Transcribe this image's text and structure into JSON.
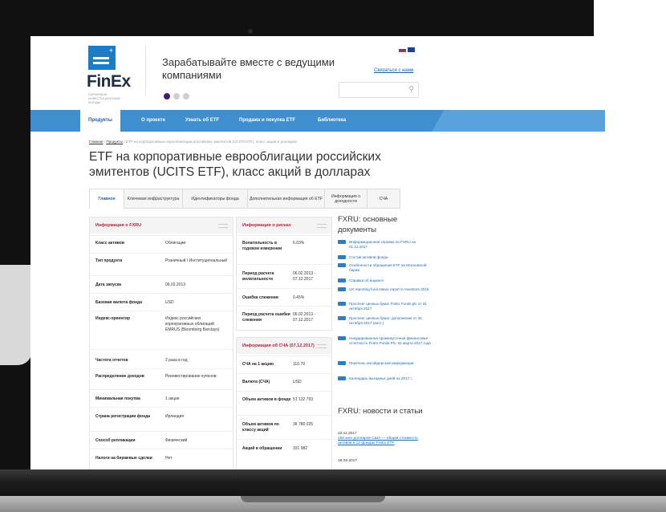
{
  "header": {
    "logo_text": "FinEx",
    "logo_sub": [
      "БИРЖЕВЫЕ",
      "ИНВЕСТИЦИОННЫЕ",
      "ФОНДЫ"
    ],
    "tagline": "Зарабатывайте вместе с ведущими компаниями",
    "contact_link": "Связаться с нами",
    "search_placeholder": ""
  },
  "nav": {
    "items": [
      "Продукты",
      "О проекте",
      "Узнать об ETF",
      "Продажа и покупка ETF",
      "Библиотека"
    ]
  },
  "breadcrumb": {
    "home": "Главная",
    "products": "Продукты",
    "current": "ETF на корпоративные еврооблигации российских эмитентов (UCITS ETF), класс акций в долларах"
  },
  "page_title": "ETF на корпоративные еврооблигации российских эмитентов (UCITS ETF), класс акций в долларах",
  "tabs": [
    "Главное",
    "Ключевая инфраструктура",
    "Идентификаторы фонда",
    "Дополнительная информация об ETF",
    "Информация о доходности",
    "СЧА"
  ],
  "info_panel": {
    "title": "Информация о FXRU",
    "rows": [
      {
        "k": "Класс активов",
        "v": "Облигации"
      },
      {
        "k": "Тип продукта",
        "v": "Розничный / Институциональный"
      },
      {
        "k": "Дата запуска",
        "v": "06.02.2013"
      },
      {
        "k": "Базовая валюта фонда",
        "v": "USD"
      },
      {
        "k": "Индекс-ориентир",
        "v": "Индекс российских корпоративных облигаций EMRUS (Bloomberg Barclays)"
      },
      {
        "k": "Частота отчетов",
        "v": "2 раза в год"
      },
      {
        "k": "Распределение доходов",
        "v": "Реинвестирование купонов"
      },
      {
        "k": "Минимальная покупка",
        "v": "1 акция"
      },
      {
        "k": "Страна регистрации фонда",
        "v": "Ирландия"
      },
      {
        "k": "Способ репликации",
        "v": "Физический"
      },
      {
        "k": "Налоги на биржевые сделки",
        "v": "Нет"
      }
    ]
  },
  "risk_panel": {
    "title": "Информация о рисках",
    "rows": [
      {
        "k": "Волатильность в годовом измерении",
        "v": "6.03%"
      },
      {
        "k": "Период расчета волатильности",
        "v": "06.02.2013 - 07.12.2017"
      },
      {
        "k": "Ошибка слежения",
        "v": "0.45%"
      },
      {
        "k": "Период расчета ошибки слежения",
        "v": "06.02.2013 - 07.12.2017"
      }
    ]
  },
  "nav_panel": {
    "title": "Информация об СЧА (07.12.2017)",
    "rows": [
      {
        "k": "СЧА на 1 акцию",
        "v": "110.79"
      },
      {
        "k": "Валюта (СЧА)",
        "v": "USD"
      },
      {
        "k": "Объем активов в фонде",
        "v": "51 132 793"
      },
      {
        "k": "Объем активов по классу акций",
        "v": "36 780 025"
      },
      {
        "k": "Акций в обращении",
        "v": "331 982"
      }
    ]
  },
  "docs": {
    "title": "FXRU: основные документы",
    "items": [
      "Информационная справка по FXRU на 01.12.2017",
      "Состав активов фонда",
      "Особенности обращения ETF на Московской бирже",
      "Справка об индексе",
      "UK reporting fund status report to Investors 2016",
      "Проспект ценных бумаг FinEx Funds plc от 31 октября 2017",
      "Проспект ценных бумаг: дополнение от 31 октября 2017 (англ.)",
      "Неаудированная промежуточная финансовая отчетность FinEx Funds Plc, 31 марта 2017 года",
      "Перечень инсайдерской информации",
      "Календарь выходных дней на 2017 г."
    ]
  },
  "news": {
    "title": "FXRU: новости и статьи",
    "items": [
      {
        "date": "23.11.2017",
        "text": "150 млн долларов США — общая стоимость активов в 12 фондах FinEx ETF"
      },
      {
        "date": "18.09.2017",
        "text": ""
      }
    ]
  }
}
